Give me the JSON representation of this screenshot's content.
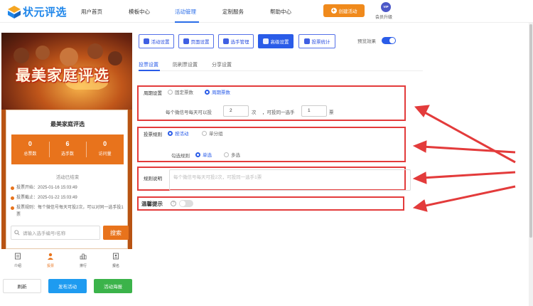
{
  "brand": {
    "name": "状元评选"
  },
  "nav": {
    "items": [
      "用户首页",
      "模板中心",
      "活动管理",
      "定制服务",
      "帮助中心"
    ],
    "active_index": 2,
    "create_label": "创建活动",
    "vip_badge": "VIP",
    "vip_label": "会员升级"
  },
  "preview": {
    "banner_title": "最美家庭评选",
    "card_title": "最美家庭评选",
    "stats": [
      {
        "value": "0",
        "label": "总票数"
      },
      {
        "value": "6",
        "label": "选手数"
      },
      {
        "value": "0",
        "label": "访问量"
      }
    ],
    "status": "活动已结束",
    "info": [
      "投票开始：2025-01-16 15:03:49",
      "投票截止：2025-01-22 15:03:49",
      "投票规则：每个微信号每天可投2次，可以对同一选手投1票"
    ],
    "search_placeholder": "请输入选手编号/名称",
    "search_button": "搜索",
    "tabs": [
      "介绍",
      "投票",
      "排行",
      "报名"
    ],
    "active_tab_index": 1
  },
  "bottom_buttons": {
    "refresh": "刷新",
    "publish": "发布活动",
    "poster": "活动海报"
  },
  "toolbar": {
    "buttons": [
      "活动设置",
      "页面设置",
      "选手管理",
      "高级设置",
      "投票统计"
    ],
    "active_index": 3,
    "preview_label": "预览效果",
    "preview_on": true
  },
  "subtabs": {
    "items": [
      "投票设置",
      "防刷票设置",
      "分享设置"
    ],
    "active_index": 0
  },
  "settings": {
    "cycle_label": "周期设置",
    "cycle_options": [
      "固定票数",
      "周期票数"
    ],
    "cycle_selected": 1,
    "per_day_prefix": "每个微信号每天可以投",
    "per_day_value": "2",
    "per_day_unit": "次",
    "same_prefix": "，可投同一选手",
    "same_value": "1",
    "same_unit": "票",
    "rule_label": "投票规则",
    "rule_options": [
      "按活动",
      "单分组"
    ],
    "rule_selected": 0,
    "check_label": "勾选规则",
    "check_options": [
      "单选",
      "多选"
    ],
    "check_selected": 0,
    "desc_label": "规则说明",
    "desc_placeholder": "每个微信号每天可投2次，可投同一选手1票",
    "tip_label": "温馨提示",
    "tip_on": false
  },
  "colors": {
    "accent": "#2a5ce8",
    "orange": "#e8731c",
    "annotation": "#e33b3b",
    "publish": "#1e9bf0",
    "poster": "#3bb34a"
  }
}
